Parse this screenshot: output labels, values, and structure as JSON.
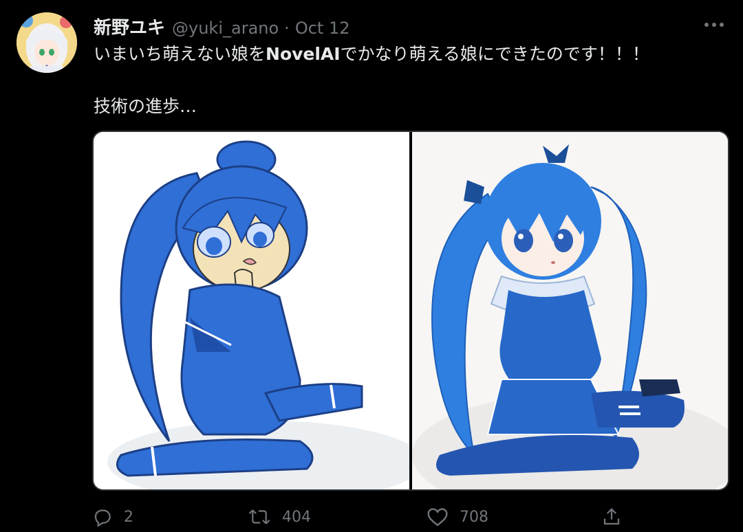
{
  "tweet": {
    "display_name": "新野ユキ",
    "handle": "@yuki_arano",
    "separator": "·",
    "date": "Oct 12",
    "more_icon": "more-horizontal-icon",
    "text_line1_a": "いまいち萌えない娘を",
    "text_line1_bold": "NovelAI",
    "text_line1_b": "でかなり萌える娘にできたのです！！！",
    "text_line2": "技術の進歩…",
    "media": [
      {
        "description_icon": "image-left-original-drawing"
      },
      {
        "description_icon": "image-right-ai-drawing"
      }
    ]
  },
  "actions": {
    "reply_count": "2",
    "retweet_count": "404",
    "like_count": "708",
    "reply_icon": "reply-icon",
    "retweet_icon": "retweet-icon",
    "like_icon": "heart-icon",
    "share_icon": "share-icon"
  },
  "colors": {
    "background": "#000000",
    "primary_text": "#e7e9ea",
    "secondary_text": "#71767b",
    "border": "#2f3336",
    "character_blue": "#2f6fd6"
  }
}
